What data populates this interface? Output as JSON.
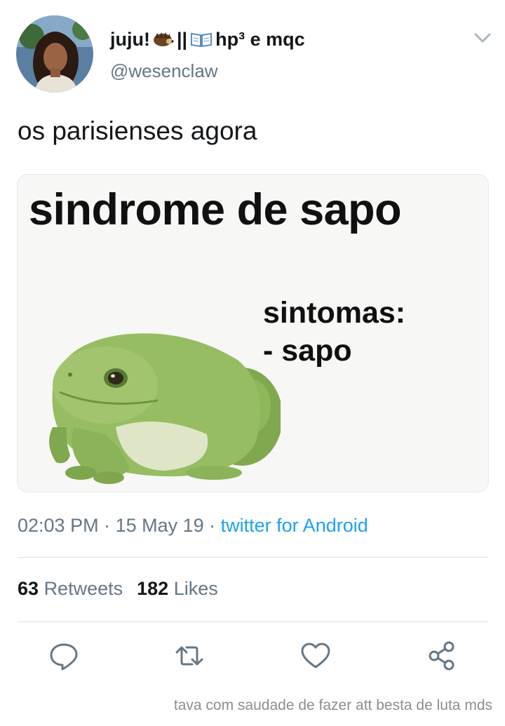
{
  "tweet": {
    "display_name_part1": "juju!",
    "display_name_sep": "||",
    "display_name_part2": "hp³ e mqc",
    "handle": "@wesenclaw",
    "text": "os parisienses agora",
    "name_icons": [
      "hedgehog-icon",
      "open-book-icon"
    ]
  },
  "media": {
    "title": "sindrome de sapo",
    "symptoms_label": "sintomas:",
    "symptoms_item": "- sapo"
  },
  "meta": {
    "time": "02:03 PM",
    "sep1": " · ",
    "date": "15 May 19",
    "sep2": " · ",
    "source": "twitter for Android"
  },
  "stats": {
    "retweets_count": "63",
    "retweets_label": "Retweets",
    "likes_count": "182",
    "likes_label": "Likes"
  },
  "actions": [
    "reply-icon",
    "retweet-icon",
    "like-icon",
    "share-icon"
  ],
  "caption": "tava com saudade de fazer att besta de luta mds",
  "colors": {
    "text": "#14171a",
    "secondary": "#657786",
    "link": "#1da1f2",
    "divider": "#d9e1e7"
  }
}
